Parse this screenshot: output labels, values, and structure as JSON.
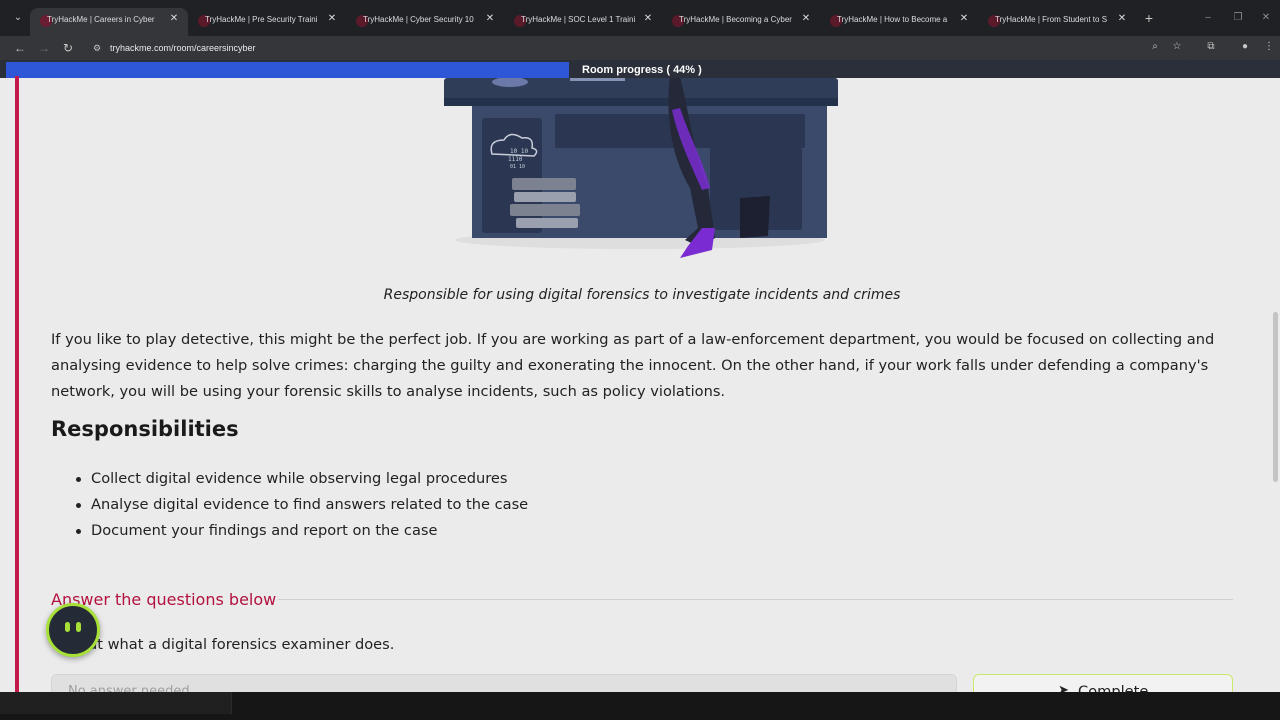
{
  "browser": {
    "tabs": [
      {
        "title": "TryHackMe | Careers in Cyber",
        "active": true
      },
      {
        "title": "TryHackMe | Pre Security Traini",
        "active": false
      },
      {
        "title": "TryHackMe | Cyber Security 10",
        "active": false
      },
      {
        "title": "TryHackMe | SOC Level 1 Traini",
        "active": false
      },
      {
        "title": "TryHackMe | Becoming a Cyber",
        "active": false
      },
      {
        "title": "TryHackMe | How to Become a",
        "active": false
      },
      {
        "title": "TryHackMe | From Student to S",
        "active": false
      }
    ],
    "url": "tryhackme.com/room/careersincyber"
  },
  "room": {
    "progress_label": "Room progress ( 44% )",
    "progress_percent": 44
  },
  "content": {
    "caption": "Responsible for using digital forensics to investigate incidents and crimes",
    "paragraph": "If you like to play detective, this might be the perfect job. If you are working as part of a law-enforcement department, you would be focused on collecting and analysing evidence to help solve crimes: charging the guilty and exonerating the innocent. On the other hand, if your work falls under defending a company's network, you will be using your forensic skills to analyse incidents, such as policy violations.",
    "heading": "Responsibilities",
    "responsibilities": [
      "Collect digital evidence while observing legal procedures",
      "Analyse digital evidence to find answers related to the case",
      "Document your findings and report on the case"
    ]
  },
  "questions": {
    "heading": "Answer the questions below",
    "question_text": "about what a digital forensics examiner does.",
    "answer_placeholder": "No answer needed",
    "complete_label": "Complete"
  }
}
